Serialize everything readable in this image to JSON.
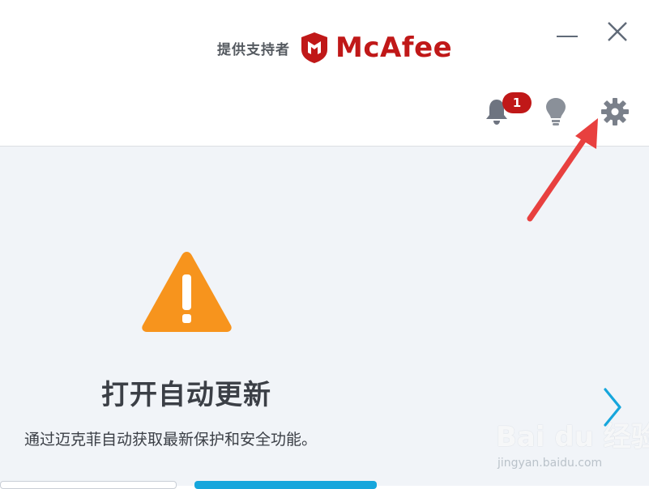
{
  "header": {
    "supported_by": "提供支持者",
    "brand_name": "McAfee",
    "brand_color": "#c01818",
    "minimize_icon": "minimize-icon",
    "close_icon": "close-icon"
  },
  "toolbar": {
    "notifications_icon": "bell-icon",
    "notification_count": "1",
    "tips_icon": "lightbulb-icon",
    "settings_icon": "gear-icon"
  },
  "alert": {
    "icon": "warning-triangle-icon",
    "icon_color": "#f7941d",
    "title": "打开自动更新",
    "description": "通过迈克菲自动获取最新保护和安全功能。",
    "next_icon": "chevron-right-icon",
    "accent_color": "#16a6dc"
  },
  "annotation": {
    "arrow_icon": "red-arrow-icon",
    "arrow_color": "#e8403f"
  },
  "watermark": {
    "main": "Bai du 经验",
    "sub": "jingyan.baidu.com"
  }
}
